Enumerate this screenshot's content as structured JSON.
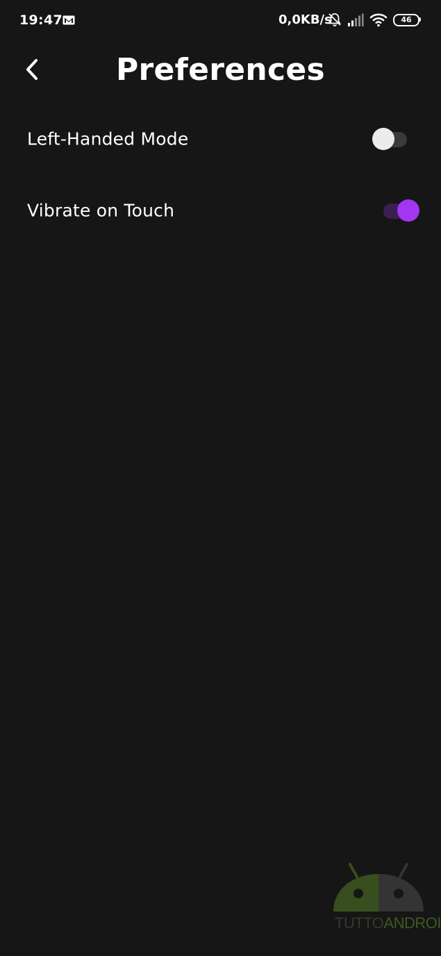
{
  "status_bar": {
    "time": "19:47",
    "net_speed": "0,0KB/s",
    "battery_level": "46",
    "icons": [
      "mail-icon",
      "bell-off-icon",
      "signal-icon",
      "wifi-icon",
      "battery-icon"
    ]
  },
  "header": {
    "title": "Preferences",
    "back_icon": "chevron-left-icon"
  },
  "settings": [
    {
      "label": "Left-Handed Mode",
      "enabled": false
    },
    {
      "label": "Vibrate on Touch",
      "enabled": true
    }
  ],
  "watermark": {
    "text_part1": "TUTTO",
    "text_part2": "ANDROID"
  },
  "colors": {
    "background": "#161616",
    "accent": "#a336f0",
    "accent_track": "#3b1e52",
    "toggle_off_thumb": "#ececec",
    "toggle_off_track": "#3a3a3a"
  }
}
